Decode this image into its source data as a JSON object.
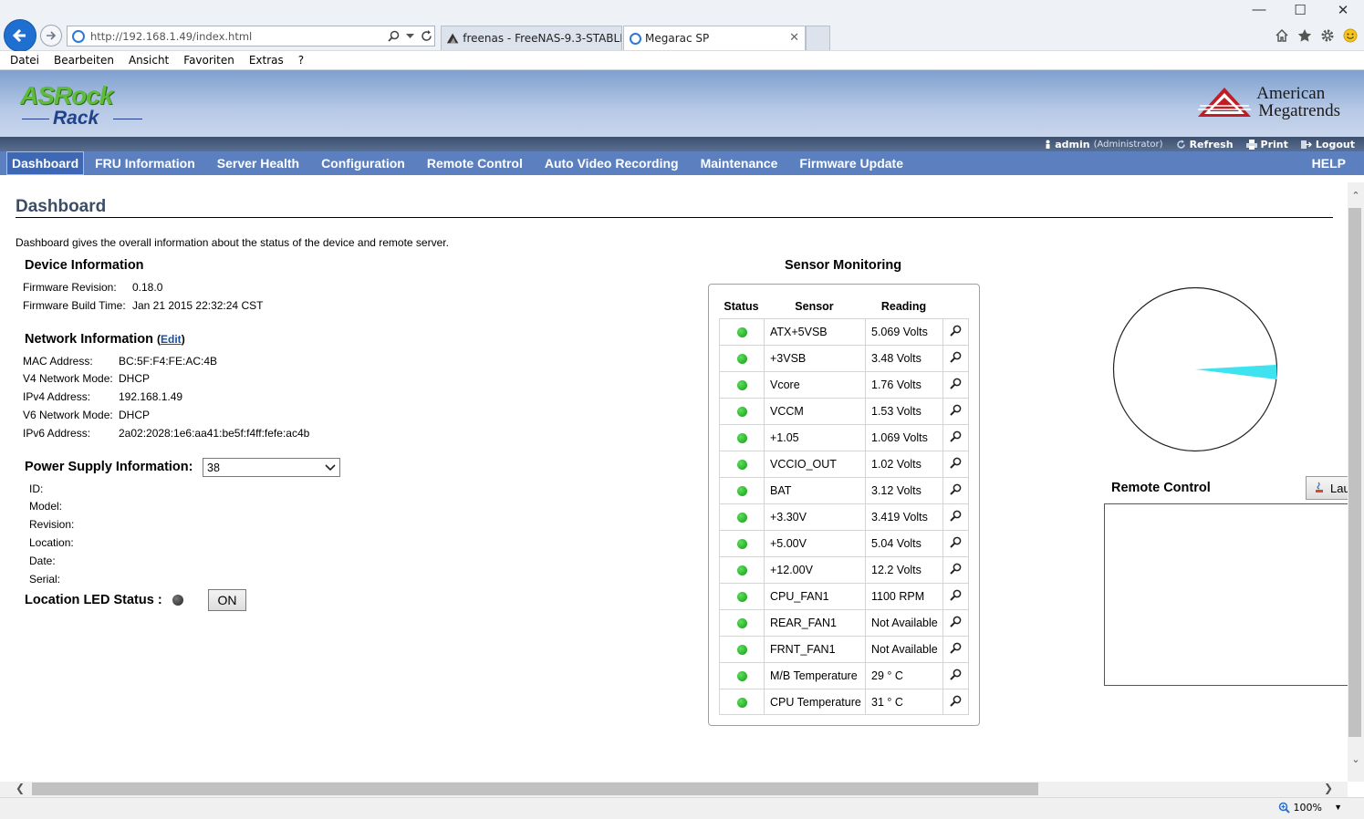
{
  "browser": {
    "url": "http://192.168.1.49/index.html",
    "tabs": [
      {
        "label": "freenas - FreeNAS-9.3-STABLE-..."
      },
      {
        "label": "Megarac SP"
      }
    ],
    "menu": [
      "Datei",
      "Bearbeiten",
      "Ansicht",
      "Favoriten",
      "Extras",
      "?"
    ],
    "zoom": "100%"
  },
  "header": {
    "logo_top": "ASRock",
    "logo_bottom": "Rack",
    "vendor_line1": "American",
    "vendor_line2": "Megatrends"
  },
  "userbar": {
    "user": "admin",
    "role": "(Administrator)",
    "refresh": "Refresh",
    "print": "Print",
    "logout": "Logout"
  },
  "nav": {
    "items": [
      "Dashboard",
      "FRU Information",
      "Server Health",
      "Configuration",
      "Remote Control",
      "Auto Video Recording",
      "Maintenance",
      "Firmware Update"
    ],
    "help": "HELP"
  },
  "page": {
    "title": "Dashboard",
    "description": "Dashboard gives the overall information about the status of the device and remote server."
  },
  "device": {
    "heading": "Device Information",
    "fw_rev_label": "Firmware Revision:",
    "fw_rev": "0.18.0",
    "fw_build_label": "Firmware Build Time:",
    "fw_build": "Jan 21 2015 22:32:24 CST"
  },
  "network": {
    "heading": "Network Information",
    "edit": "Edit",
    "rows": [
      {
        "label": "MAC Address:",
        "value": "BC:5F:F4:FE:AC:4B"
      },
      {
        "label": "V4 Network Mode:",
        "value": "DHCP"
      },
      {
        "label": "IPv4 Address:",
        "value": "192.168.1.49"
      },
      {
        "label": "V6 Network Mode:",
        "value": "DHCP"
      },
      {
        "label": "IPv6 Address:",
        "value": "2a02:2028:1e6:aa41:be5f:f4ff:fefe:ac4b"
      }
    ]
  },
  "power": {
    "heading": "Power Supply Information:",
    "selected": "38",
    "fields": [
      "ID:",
      "Model:",
      "Revision:",
      "Location:",
      "Date:",
      "Serial:"
    ]
  },
  "led": {
    "label": "Location LED Status :",
    "button": "ON"
  },
  "sensors": {
    "title": "Sensor Monitoring",
    "headers": [
      "Status",
      "Sensor",
      "Reading"
    ],
    "rows": [
      {
        "name": "ATX+5VSB",
        "reading": "5.069 Volts"
      },
      {
        "name": "+3VSB",
        "reading": "3.48 Volts"
      },
      {
        "name": "Vcore",
        "reading": "1.76 Volts"
      },
      {
        "name": "VCCM",
        "reading": "1.53 Volts"
      },
      {
        "name": "+1.05",
        "reading": "1.069 Volts"
      },
      {
        "name": "VCCIO_OUT",
        "reading": "1.02 Volts"
      },
      {
        "name": "BAT",
        "reading": "3.12 Volts"
      },
      {
        "name": "+3.30V",
        "reading": "3.419 Volts"
      },
      {
        "name": "+5.00V",
        "reading": "5.04 Volts"
      },
      {
        "name": "+12.00V",
        "reading": "12.2 Volts"
      },
      {
        "name": "CPU_FAN1",
        "reading": "1100 RPM"
      },
      {
        "name": "REAR_FAN1",
        "reading": "Not Available"
      },
      {
        "name": "FRNT_FAN1",
        "reading": "Not Available"
      },
      {
        "name": "M/B Temperature",
        "reading": "29 ° C"
      },
      {
        "name": "CPU Temperature",
        "reading": "31 ° C"
      }
    ],
    "status_color": "#1fa61f"
  },
  "remote": {
    "title": "Remote Control",
    "launch": "Lau"
  },
  "colors": {
    "nav_bg": "#5b7fbf",
    "accent": "#1f6fd0"
  }
}
